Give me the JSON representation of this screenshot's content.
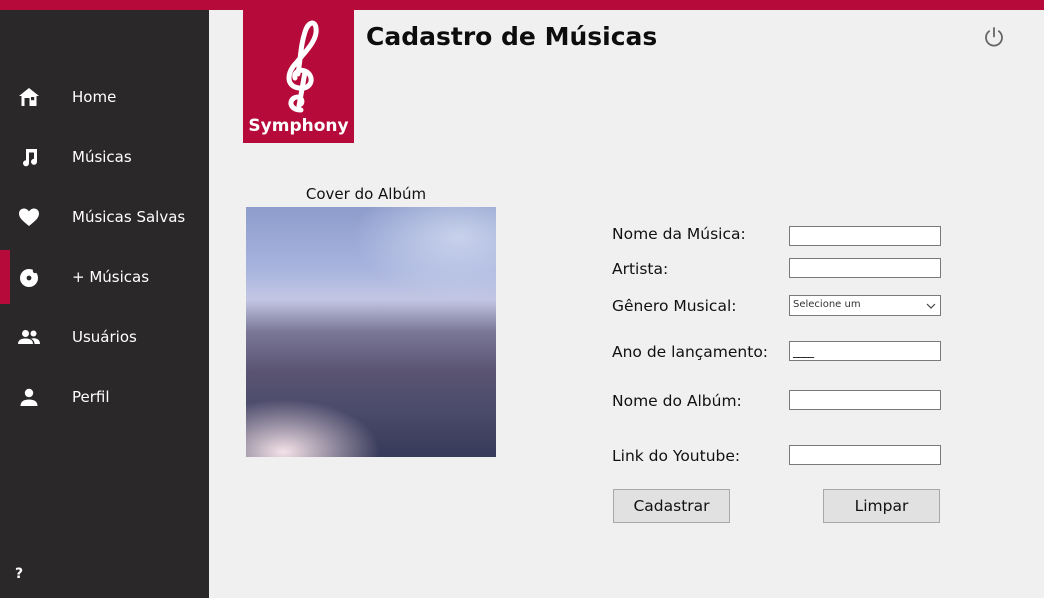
{
  "app": {
    "brand": "Symphony",
    "page_title": "Cadastro de Músicas",
    "accent_color": "#b50a3a",
    "sidebar_color": "#2a2829"
  },
  "sidebar": {
    "items": [
      {
        "label": "Home",
        "icon": "home-icon"
      },
      {
        "label": "Músicas",
        "icon": "music-note-icon"
      },
      {
        "label": "Músicas Salvas",
        "icon": "heart-icon"
      },
      {
        "label": "+ Músicas",
        "icon": "disc-icon",
        "active": true
      },
      {
        "label": "Usuários",
        "icon": "users-icon"
      },
      {
        "label": "Perfil",
        "icon": "person-icon"
      }
    ],
    "help_label": "?"
  },
  "cover": {
    "label": "Cover do Albúm"
  },
  "form": {
    "song_name_label": "Nome da Música:",
    "song_name_value": "",
    "artist_label": "Artista:",
    "artist_value": "",
    "genre_label": "Gênero Musical:",
    "genre_selected": "Selecione um",
    "year_label": "Ano de lançamento:",
    "year_mask": "____",
    "album_label": "Nome do Albúm:",
    "album_value": "",
    "youtube_label": "Link do Youtube:",
    "youtube_value": ""
  },
  "buttons": {
    "submit_label": "Cadastrar",
    "clear_label": "Limpar"
  },
  "header": {
    "power_icon": "power-icon"
  }
}
